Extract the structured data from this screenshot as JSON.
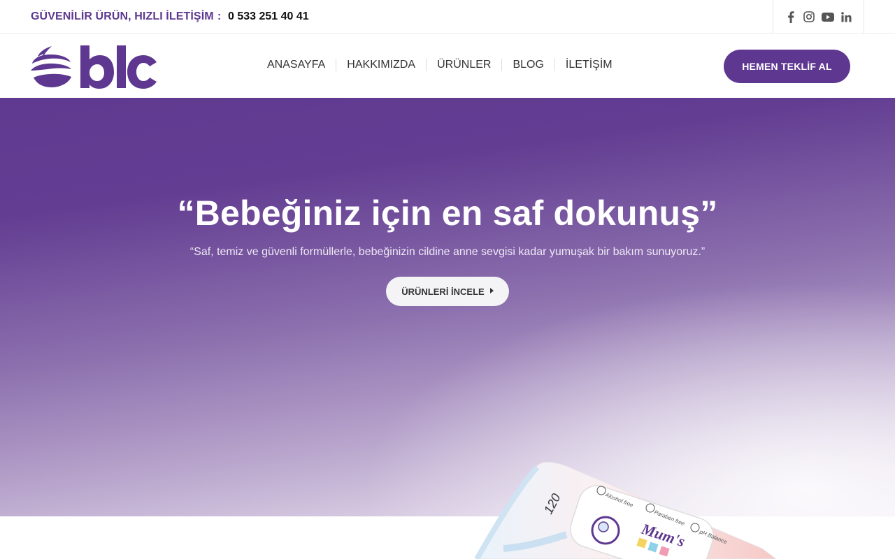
{
  "topbar": {
    "tagline": "GÜVENİLİR ÜRÜN, HIZLI İLETİŞİM",
    "separator": ":",
    "phone": "0 533 251 40 41",
    "social_icons": [
      "facebook-icon",
      "instagram-icon",
      "youtube-icon",
      "linkedin-icon"
    ]
  },
  "header": {
    "logo_text": "blc",
    "nav": [
      {
        "label": "ANASAYFA"
      },
      {
        "label": "HAKKIMIZDA"
      },
      {
        "label": "ÜRÜNLER"
      },
      {
        "label": "BLOG"
      },
      {
        "label": "İLETİŞİM"
      }
    ],
    "cta_label": "HEMEN TEKLİF AL"
  },
  "hero": {
    "title": "“Bebeğiniz için en saf dokunuş”",
    "subtitle": "“Saf, temiz ve güvenli formüllerle, bebeğinizin cildine anne sevgisi kadar yumuşak bir bakım sunuyoruz.”",
    "button_label": "ÜRÜNLERİ İNCELE"
  },
  "product": {
    "count_label": "120",
    "brand_label": "Mum's",
    "feature_labels": [
      "Alcohol free",
      "Paraben free",
      "pH Balance"
    ]
  },
  "colors": {
    "brand": "#5e3890",
    "hero_top": "#5f3a90",
    "hero_bottom": "#ece6f1",
    "text_dark": "#111111"
  }
}
